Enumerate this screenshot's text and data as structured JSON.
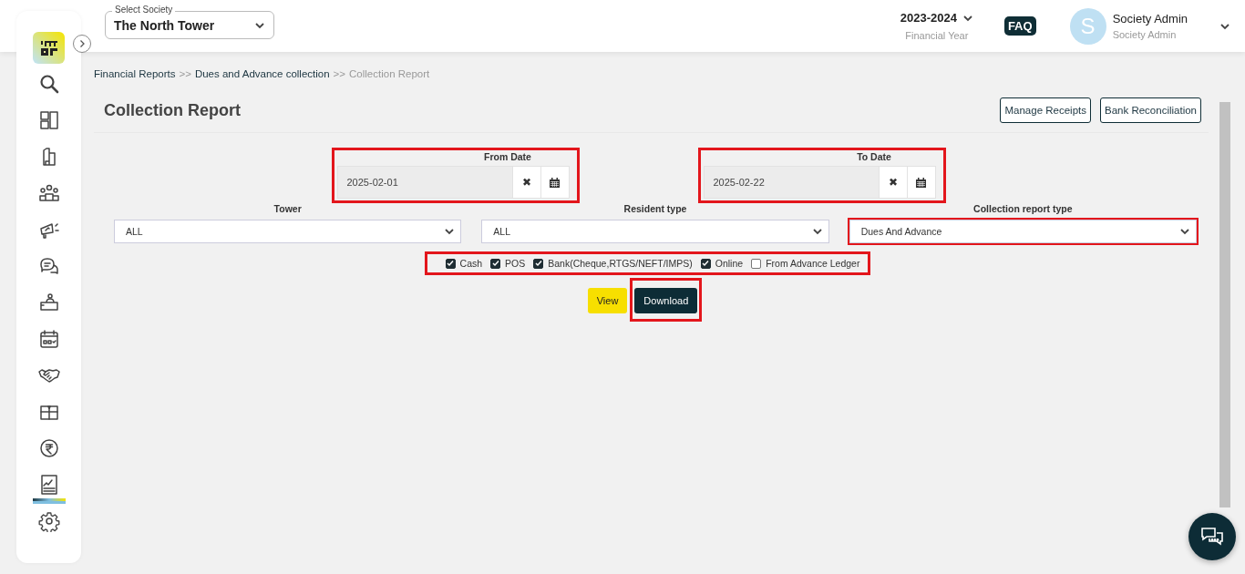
{
  "header": {
    "society_select": {
      "label": "Select Society",
      "value": "The North Tower"
    },
    "financial_year": {
      "value": "2023-2024",
      "label": "Financial Year"
    },
    "faq": "FAQ",
    "user": {
      "initial": "S",
      "name": "Society Admin",
      "role": "Society Admin"
    }
  },
  "sidebar": {
    "items": [
      {
        "kind": "search",
        "selected": false
      },
      {
        "kind": "grid",
        "selected": false
      },
      {
        "kind": "building",
        "selected": false
      },
      {
        "kind": "people",
        "selected": false
      },
      {
        "kind": "megaphone",
        "selected": false
      },
      {
        "kind": "chat",
        "selected": false
      },
      {
        "kind": "desk",
        "selected": false
      },
      {
        "kind": "calendar",
        "selected": false
      },
      {
        "kind": "handshake",
        "selected": false
      },
      {
        "kind": "box",
        "selected": false
      },
      {
        "kind": "rupee",
        "selected": false
      },
      {
        "kind": "chart",
        "selected": true
      },
      {
        "kind": "gear",
        "selected": false
      }
    ]
  },
  "breadcrumb": [
    {
      "label": "Financial Reports",
      "current": false
    },
    {
      "label": "Dues and Advance collection",
      "current": false
    },
    {
      "label": "Collection Report",
      "current": true
    }
  ],
  "breadcrumb_separator": ">>",
  "page_title": "Collection Report",
  "actions": [
    "Manage Receipts",
    "Bank Reconciliation"
  ],
  "dates": [
    {
      "label": "From Date",
      "value": "2025-02-01",
      "clear": "✖",
      "highlighted": true
    },
    {
      "label": "To Date",
      "value": "2025-02-22",
      "clear": "✖",
      "highlighted": true
    }
  ],
  "filters": [
    {
      "label": "Tower",
      "value": "ALL",
      "highlighted": false
    },
    {
      "label": "Resident type",
      "value": "ALL",
      "highlighted": false
    },
    {
      "label": "Collection report type",
      "value": "Dues And Advance",
      "highlighted": true
    }
  ],
  "payment_methods": {
    "highlighted": true,
    "options": [
      {
        "label": "Cash",
        "checked": true
      },
      {
        "label": "POS",
        "checked": true
      },
      {
        "label": "Bank(Cheque,RTGS/NEFT/IMPS)",
        "checked": true
      },
      {
        "label": "Online",
        "checked": true
      },
      {
        "label": "From Advance Ledger",
        "checked": false
      }
    ]
  },
  "buttons": [
    {
      "label": "View",
      "kind": "secondary",
      "highlighted": false
    },
    {
      "label": "Download",
      "kind": "primary",
      "highlighted": true
    }
  ]
}
